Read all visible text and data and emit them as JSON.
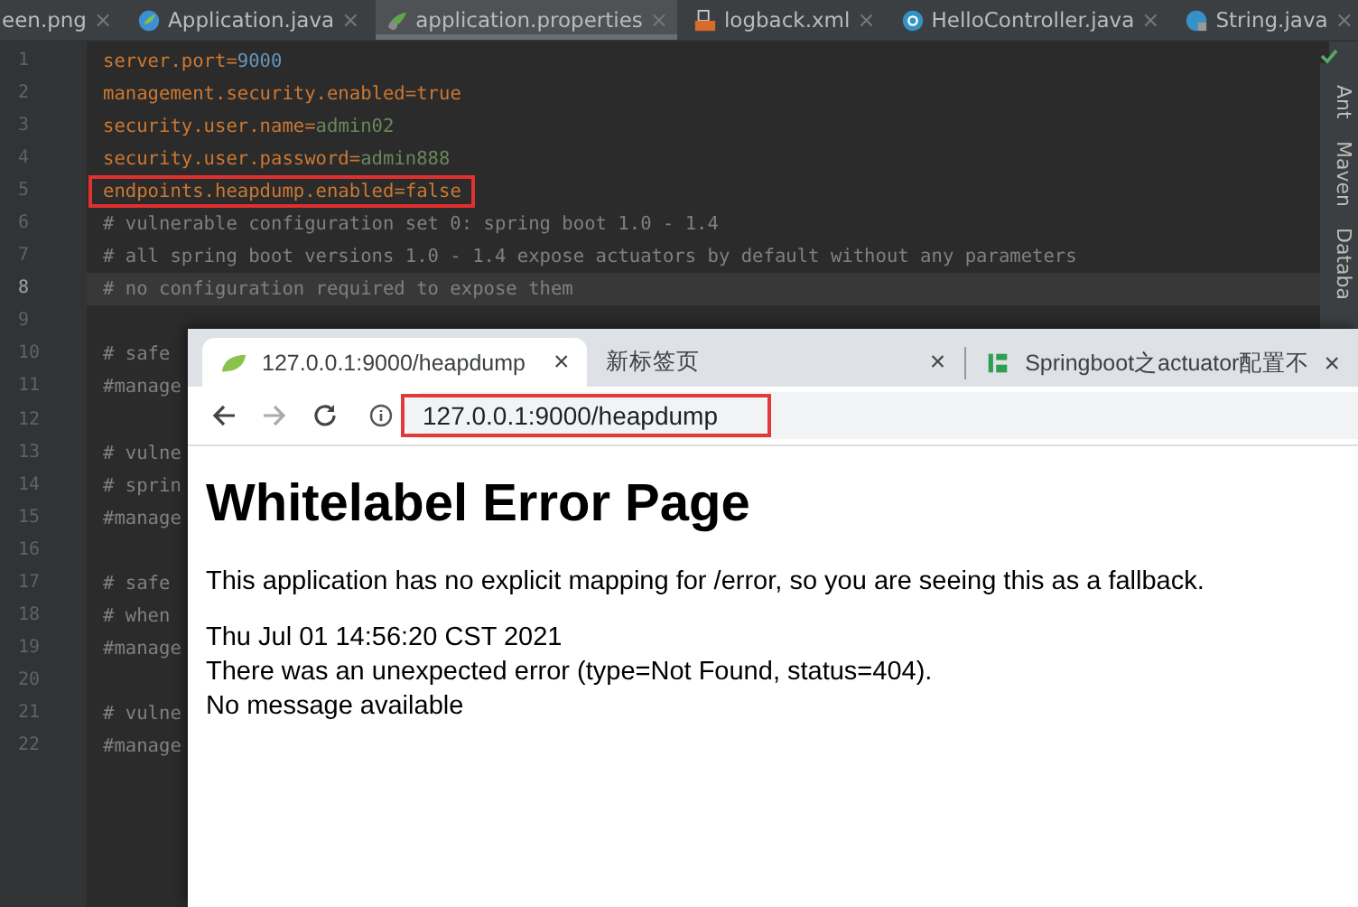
{
  "editor_tabs": [
    {
      "label": "een.png",
      "kind": "image",
      "close": "×",
      "selected": false
    },
    {
      "label": "Application.java",
      "kind": "spring",
      "close": "×",
      "selected": false
    },
    {
      "label": "application.properties",
      "kind": "properties",
      "close": "×",
      "selected": true
    },
    {
      "label": "logback.xml",
      "kind": "xml",
      "close": "×",
      "selected": false
    },
    {
      "label": "HelloController.java",
      "kind": "class",
      "close": "×",
      "selected": false
    },
    {
      "label": "String.java",
      "kind": "library",
      "close": "×",
      "selected": false
    }
  ],
  "code_lines": [
    {
      "number": "1",
      "parts": [
        {
          "text": "server.port",
          "kind": "key"
        },
        {
          "text": "=",
          "kind": "operator"
        },
        {
          "text": "9000",
          "kind": "number"
        }
      ],
      "highlighted": false,
      "current": false
    },
    {
      "number": "2",
      "parts": [
        {
          "text": "management.security.enabled",
          "kind": "key"
        },
        {
          "text": "=",
          "kind": "operator"
        },
        {
          "text": "true",
          "kind": "keyword"
        }
      ],
      "highlighted": false,
      "current": false
    },
    {
      "number": "3",
      "parts": [
        {
          "text": "security.user.name",
          "kind": "key"
        },
        {
          "text": "=",
          "kind": "operator"
        },
        {
          "text": "admin02",
          "kind": "string"
        }
      ],
      "highlighted": false,
      "current": false
    },
    {
      "number": "4",
      "parts": [
        {
          "text": "security.user.password",
          "kind": "key"
        },
        {
          "text": "=",
          "kind": "operator"
        },
        {
          "text": "admin888",
          "kind": "string"
        }
      ],
      "highlighted": false,
      "current": false
    },
    {
      "number": "5",
      "parts": [
        {
          "text": "endpoints.heapdump.enabled",
          "kind": "key"
        },
        {
          "text": "=",
          "kind": "operator"
        },
        {
          "text": "false",
          "kind": "keyword"
        }
      ],
      "highlighted": true,
      "current": false
    },
    {
      "number": "6",
      "parts": [
        {
          "text": "# vulnerable configuration set 0: spring boot 1.0 - 1.4",
          "kind": "comment"
        }
      ],
      "highlighted": false,
      "current": false
    },
    {
      "number": "7",
      "parts": [
        {
          "text": "# all spring boot versions 1.0 - 1.4 expose actuators by default without any parameters",
          "kind": "comment"
        }
      ],
      "highlighted": false,
      "current": false
    },
    {
      "number": "8",
      "parts": [
        {
          "text": "# no configuration required to expose them",
          "kind": "comment"
        }
      ],
      "highlighted": false,
      "current": true
    },
    {
      "number": "9",
      "highlighted": false,
      "current": false
    },
    {
      "number": "10",
      "parts": [
        {
          "text": "# safe",
          "kind": "comment"
        }
      ],
      "highlighted": false,
      "current": false
    },
    {
      "number": "11",
      "parts": [
        {
          "text": "#manage",
          "kind": "comment"
        }
      ],
      "highlighted": false,
      "current": false
    },
    {
      "number": "12",
      "highlighted": false,
      "current": false
    },
    {
      "number": "13",
      "parts": [
        {
          "text": "# vulne",
          "kind": "comment"
        }
      ],
      "highlighted": false,
      "current": false
    },
    {
      "number": "14",
      "parts": [
        {
          "text": "# sprin",
          "kind": "comment"
        }
      ],
      "highlighted": false,
      "current": false
    },
    {
      "number": "15",
      "parts": [
        {
          "text": "#manage",
          "kind": "comment"
        }
      ],
      "highlighted": false,
      "current": false
    },
    {
      "number": "16",
      "highlighted": false,
      "current": false
    },
    {
      "number": "17",
      "parts": [
        {
          "text": "# safe",
          "kind": "comment"
        }
      ],
      "highlighted": false,
      "current": false
    },
    {
      "number": "18",
      "parts": [
        {
          "text": "# when",
          "kind": "comment"
        }
      ],
      "highlighted": false,
      "current": false
    },
    {
      "number": "19",
      "parts": [
        {
          "text": "#manage",
          "kind": "comment"
        }
      ],
      "highlighted": false,
      "current": false
    },
    {
      "number": "20",
      "highlighted": false,
      "current": false
    },
    {
      "number": "21",
      "parts": [
        {
          "text": "# vulne",
          "kind": "comment"
        }
      ],
      "highlighted": false,
      "current": false
    },
    {
      "number": "22",
      "parts": [
        {
          "text": "#manage",
          "kind": "comment"
        }
      ],
      "highlighted": false,
      "current": false
    }
  ],
  "side_tools": [
    "Ant",
    "Maven",
    "Databa"
  ],
  "browser": {
    "tabs": [
      {
        "label": "127.0.0.1:9000/heapdump",
        "kind": "leaf",
        "close": "×",
        "selected": true
      },
      {
        "label": "新标签页",
        "kind": "none",
        "close": "×",
        "selected": false
      },
      {
        "label": "Springboot之actuator配置不",
        "kind": "site",
        "close": "×",
        "selected": false
      }
    ],
    "address": "127.0.0.1:9000/heapdump",
    "address_highlighted": true,
    "page": {
      "heading": "Whitelabel Error Page",
      "intro": "This application has no explicit mapping for /error, so you are seeing this as a fallback.",
      "lines": [
        "Thu Jul 01 14:56:20 CST 2021",
        "There was an unexpected error (type=Not Found, status=404).",
        "No message available"
      ]
    }
  }
}
